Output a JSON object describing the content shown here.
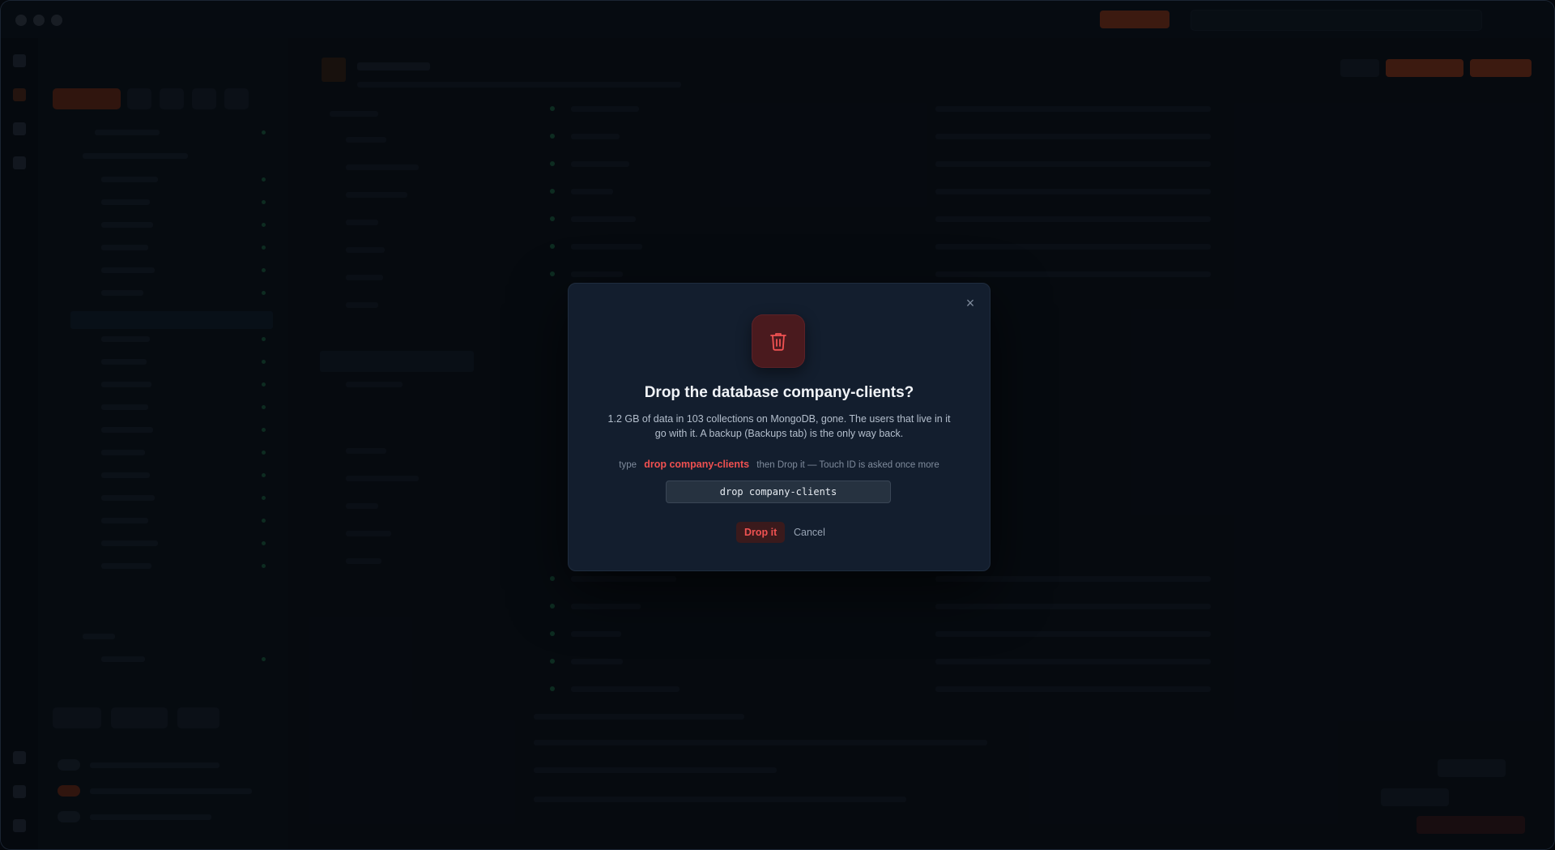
{
  "dialog": {
    "title": "Drop the database company-clients?",
    "description": "1.2 GB of data in 103 collections on MongoDB, gone. The users that live in it go with it. A backup (Backups tab) is the only way back.",
    "confirm_prefix": "type",
    "confirm_phrase": "drop company-clients",
    "confirm_suffix": "then Drop it — Touch ID is asked once more",
    "input_value": "drop company-clients",
    "drop_label": "Drop it",
    "cancel_label": "Cancel",
    "close_glyph": "×",
    "icon": "trash-icon"
  },
  "colors": {
    "danger": "#ef5050",
    "accent": "#9a3a1c",
    "dialog_bg": "#131e2e",
    "backdrop": "#05080d"
  }
}
